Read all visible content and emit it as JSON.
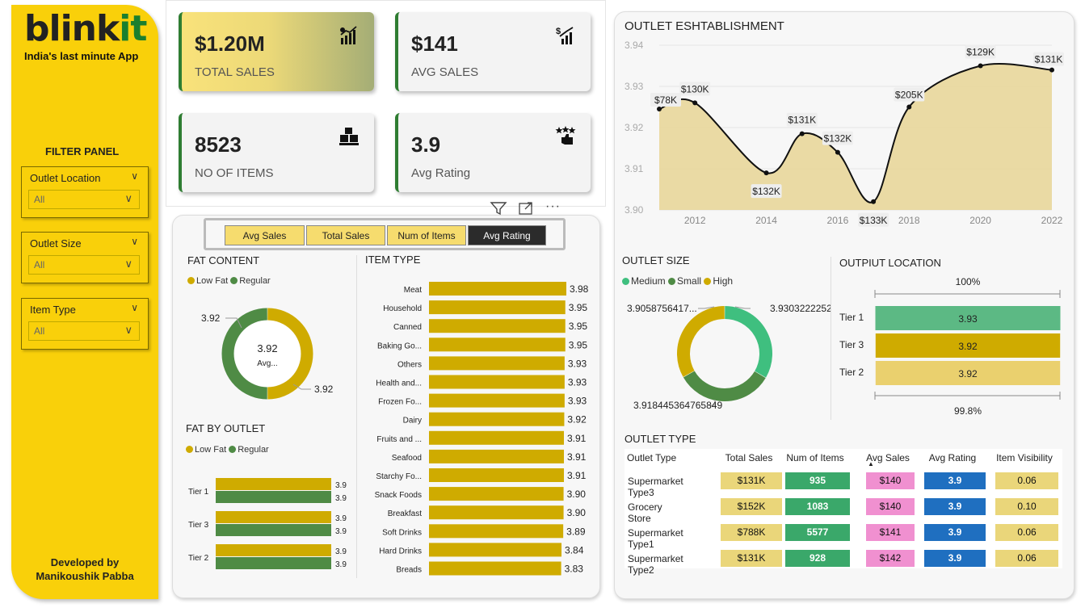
{
  "app": {
    "logo_main": "blink",
    "logo_accent": "it",
    "tagline": "India's last minute App",
    "developed_by": "Developed by",
    "developer": "Manikoushik Pabba"
  },
  "filter_panel": {
    "title": "FILTER PANEL",
    "filters": [
      {
        "label": "Outlet Location",
        "value": "All"
      },
      {
        "label": "Outlet Size",
        "value": "All"
      },
      {
        "label": "Item Type",
        "value": "All"
      }
    ]
  },
  "kpis": [
    {
      "value": "$1.20M",
      "label": "TOTAL SALES",
      "icon": "sales-chart-icon"
    },
    {
      "value": "$141",
      "label": "AVG SALES",
      "icon": "dollar-growth-icon"
    },
    {
      "value": "8523",
      "label": "NO OF ITEMS",
      "icon": "boxes-icon"
    },
    {
      "value": "3.9",
      "label": "Avg Rating",
      "icon": "rating-stars-icon"
    }
  ],
  "metric_switch": {
    "options": [
      "Avg Sales",
      "Total Sales",
      "Num of Items",
      "Avg Rating"
    ],
    "selected": "Avg Rating"
  },
  "colors": {
    "gold": "#cfab00",
    "green": "#4f8b45",
    "light_gold": "#ead06e",
    "teal": "#3fbf7f",
    "table_green": "#3aa86a",
    "pink": "#f090d0",
    "blue": "#1f6fc0",
    "pale": "#ead67a"
  },
  "chart_data": [
    {
      "type": "area",
      "title": "OUTLET ESHTABLISHMENT",
      "x": [
        2011,
        2012,
        2014,
        2015,
        2016,
        2017,
        2018,
        2020,
        2022
      ],
      "x_ticks": [
        "2012",
        "2014",
        "2016",
        "2018",
        "2020",
        "2022"
      ],
      "y": [
        3.9245,
        3.926,
        3.909,
        3.9185,
        3.914,
        3.902,
        3.925,
        3.935,
        3.934
      ],
      "labels": [
        "$78K",
        "$130K",
        "$132K",
        "$131K",
        "$132K",
        "$133K",
        "$205K",
        "$129K",
        "$131K"
      ],
      "y_ticks": [
        "3.94",
        "3.93",
        "3.92",
        "3.91",
        "3.90"
      ],
      "ylim": [
        3.9,
        3.94
      ]
    },
    {
      "type": "pie",
      "title": "FAT CONTENT",
      "legend": [
        "Low Fat",
        "Regular"
      ],
      "values": [
        3.92,
        3.92
      ],
      "slice_labels": [
        "3.92",
        "3.92"
      ],
      "center_value": "3.92",
      "center_label": "Avg..."
    },
    {
      "type": "bar",
      "title": "ITEM TYPE",
      "categories": [
        "Meat",
        "Household",
        "Canned",
        "Baking Go...",
        "Others",
        "Health and...",
        "Frozen Fo...",
        "Dairy",
        "Fruits and ...",
        "Seafood",
        "Starchy Fo...",
        "Snack Foods",
        "Breakfast",
        "Soft Drinks",
        "Hard Drinks",
        "Breads"
      ],
      "values": [
        3.98,
        3.95,
        3.95,
        3.95,
        3.93,
        3.93,
        3.93,
        3.92,
        3.91,
        3.91,
        3.91,
        3.9,
        3.9,
        3.89,
        3.84,
        3.83
      ]
    },
    {
      "type": "bar",
      "title": "FAT BY OUTLET",
      "legend": [
        "Low Fat",
        "Regular"
      ],
      "categories": [
        "Tier 1",
        "Tier 3",
        "Tier 2"
      ],
      "series": [
        {
          "name": "Low Fat",
          "values": [
            3.9,
            3.9,
            3.9
          ]
        },
        {
          "name": "Regular",
          "values": [
            3.9,
            3.9,
            3.9
          ]
        }
      ]
    },
    {
      "type": "pie",
      "title": "OUTLET SIZE",
      "legend": [
        "Medium",
        "Small",
        "High"
      ],
      "values": [
        3.9303222252,
        3.918445364765849,
        3.9058756417
      ],
      "slice_labels": [
        "3.9303222252 ...",
        "3.918445364765849",
        "3.9058756417..."
      ]
    },
    {
      "type": "bar",
      "title": "OUTPIUT LOCATION",
      "categories": [
        "Tier 1",
        "Tier 3",
        "Tier 2"
      ],
      "values": [
        3.93,
        3.92,
        3.92
      ],
      "value_labels": [
        "3.93",
        "3.92",
        "3.92"
      ],
      "top_label": "100%",
      "bottom_label": "99.8%"
    },
    {
      "type": "table",
      "title": "OUTLET TYPE",
      "columns": [
        "Outlet Type",
        "Total Sales",
        "Num of Items",
        "Avg Sales",
        "Avg Rating",
        "Item Visibility"
      ],
      "rows": [
        [
          "Supermarket Type3",
          "$131K",
          "935",
          "$140",
          "3.9",
          "0.06"
        ],
        [
          "Grocery Store",
          "$152K",
          "1083",
          "$140",
          "3.9",
          "0.10"
        ],
        [
          "Supermarket Type1",
          "$788K",
          "5577",
          "$141",
          "3.9",
          "0.06"
        ],
        [
          "Supermarket Type2",
          "$131K",
          "928",
          "$142",
          "3.9",
          "0.06"
        ]
      ]
    }
  ]
}
